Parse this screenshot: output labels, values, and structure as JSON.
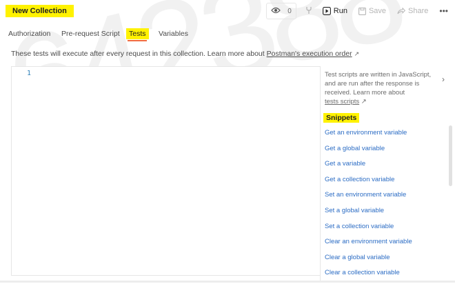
{
  "header": {
    "title": "New Collection",
    "watch_count": "0",
    "run_label": "Run",
    "save_label": "Save",
    "share_label": "Share",
    "more_label": "•••"
  },
  "tabs": [
    {
      "label": "Authorization"
    },
    {
      "label": "Pre-request Script"
    },
    {
      "label": "Tests",
      "active": true
    },
    {
      "label": "Variables"
    }
  ],
  "info": {
    "text": "These tests will execute after every request in this collection. Learn more about ",
    "link": "Postman's execution order",
    "arrow": "↗"
  },
  "editor": {
    "line_numbers": [
      "1"
    ]
  },
  "sidebar": {
    "desc_line1": "Test scripts are written in JavaScript,",
    "desc_line2": "and are run after the response is",
    "desc_line3": "received. Learn more about",
    "desc_link": "tests scripts",
    "desc_arrow": "↗",
    "snippets_title": "Snippets",
    "snippets": [
      "Get an environment variable",
      "Get a global variable",
      "Get a variable",
      "Get a collection variable",
      "Set an environment variable",
      "Set a global variable",
      "Set a collection variable",
      "Clear an environment variable",
      "Clear a global variable",
      "Clear a collection variable"
    ]
  },
  "watermark": "642388",
  "colors": {
    "highlight": "#fff200",
    "active_tab_underline": "#f26b3a",
    "snippet_link": "#2b6cc4",
    "line_number": "#2d7fb8"
  }
}
